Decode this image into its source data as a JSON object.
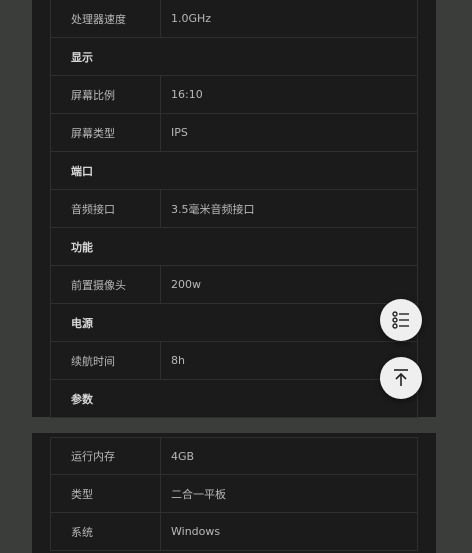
{
  "card1": {
    "rows": [
      {
        "type": "row",
        "label": "处理器速度",
        "value": "1.0GHz"
      },
      {
        "type": "section",
        "label": "显示"
      },
      {
        "type": "row",
        "label": "屏幕比例",
        "value": "16:10"
      },
      {
        "type": "row",
        "label": "屏幕类型",
        "value": "IPS"
      },
      {
        "type": "section",
        "label": "端口"
      },
      {
        "type": "row",
        "label": "音频接口",
        "value": "3.5毫米音频接口"
      },
      {
        "type": "section",
        "label": "功能"
      },
      {
        "type": "row",
        "label": "前置摄像头",
        "value": "200w"
      },
      {
        "type": "section",
        "label": "电源"
      },
      {
        "type": "row",
        "label": "续航时间",
        "value": "8h"
      },
      {
        "type": "section",
        "label": "参数"
      }
    ]
  },
  "card2": {
    "rows": [
      {
        "type": "row",
        "label": "运行内存",
        "value": "4GB"
      },
      {
        "type": "row",
        "label": "类型",
        "value": "二合一平板"
      },
      {
        "type": "row",
        "label": "系统",
        "value": "Windows"
      }
    ]
  },
  "fabs": {
    "filter_icon": "list-filter-icon",
    "top_icon": "back-to-top-icon"
  },
  "colors": {
    "background": "#3a3d39",
    "card": "#1b1b1b",
    "fab": "#efefef"
  }
}
